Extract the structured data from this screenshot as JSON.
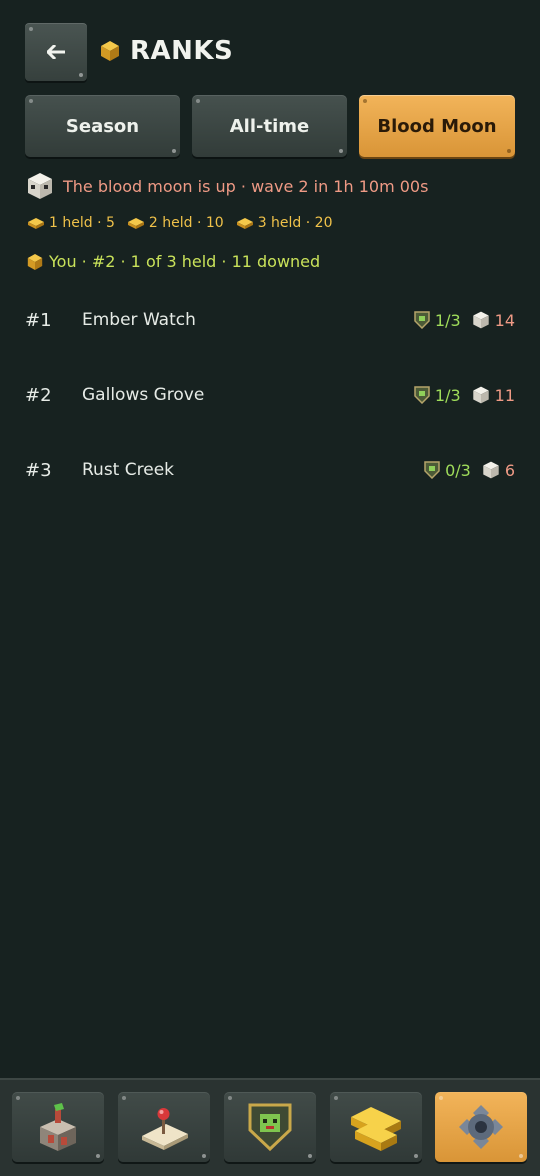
{
  "header": {
    "back_icon": "arrow-left-icon",
    "title": "RANKS",
    "title_icon": "gold-cube-icon"
  },
  "tabs": [
    {
      "label": "Season",
      "active": false
    },
    {
      "label": "All-time",
      "active": false
    },
    {
      "label": "Blood Moon",
      "active": true
    }
  ],
  "status": {
    "icon": "skull-icon",
    "text": "The blood moon is up · wave 2 in 1h 10m 00s"
  },
  "rewards": [
    {
      "label": "1 held · 5"
    },
    {
      "label": "2 held · 10"
    },
    {
      "label": "3 held · 20"
    }
  ],
  "you": {
    "text": "You · #2 · 1 of 3 held · 11 downed"
  },
  "ranks": [
    {
      "rank": "#1",
      "name": "Ember Watch",
      "held": "1/3",
      "downed": "14"
    },
    {
      "rank": "#2",
      "name": "Gallows Grove",
      "held": "1/3",
      "downed": "11"
    },
    {
      "rank": "#3",
      "name": "Rust Creek",
      "held": "0/3",
      "downed": "6"
    }
  ],
  "colors": {
    "accent": "#e5a548",
    "background": "#172220",
    "status_text": "#ef9a85",
    "you_text": "#c9e25a",
    "held_text": "#9fdc5a",
    "reward_text": "#f0c24a"
  },
  "bottom_nav": [
    {
      "icon": "tower-icon",
      "active": false
    },
    {
      "icon": "map-pin-icon",
      "active": false
    },
    {
      "icon": "zombie-shield-icon",
      "active": false
    },
    {
      "icon": "gold-bars-icon",
      "active": false
    },
    {
      "icon": "gear-icon",
      "active": true
    }
  ]
}
